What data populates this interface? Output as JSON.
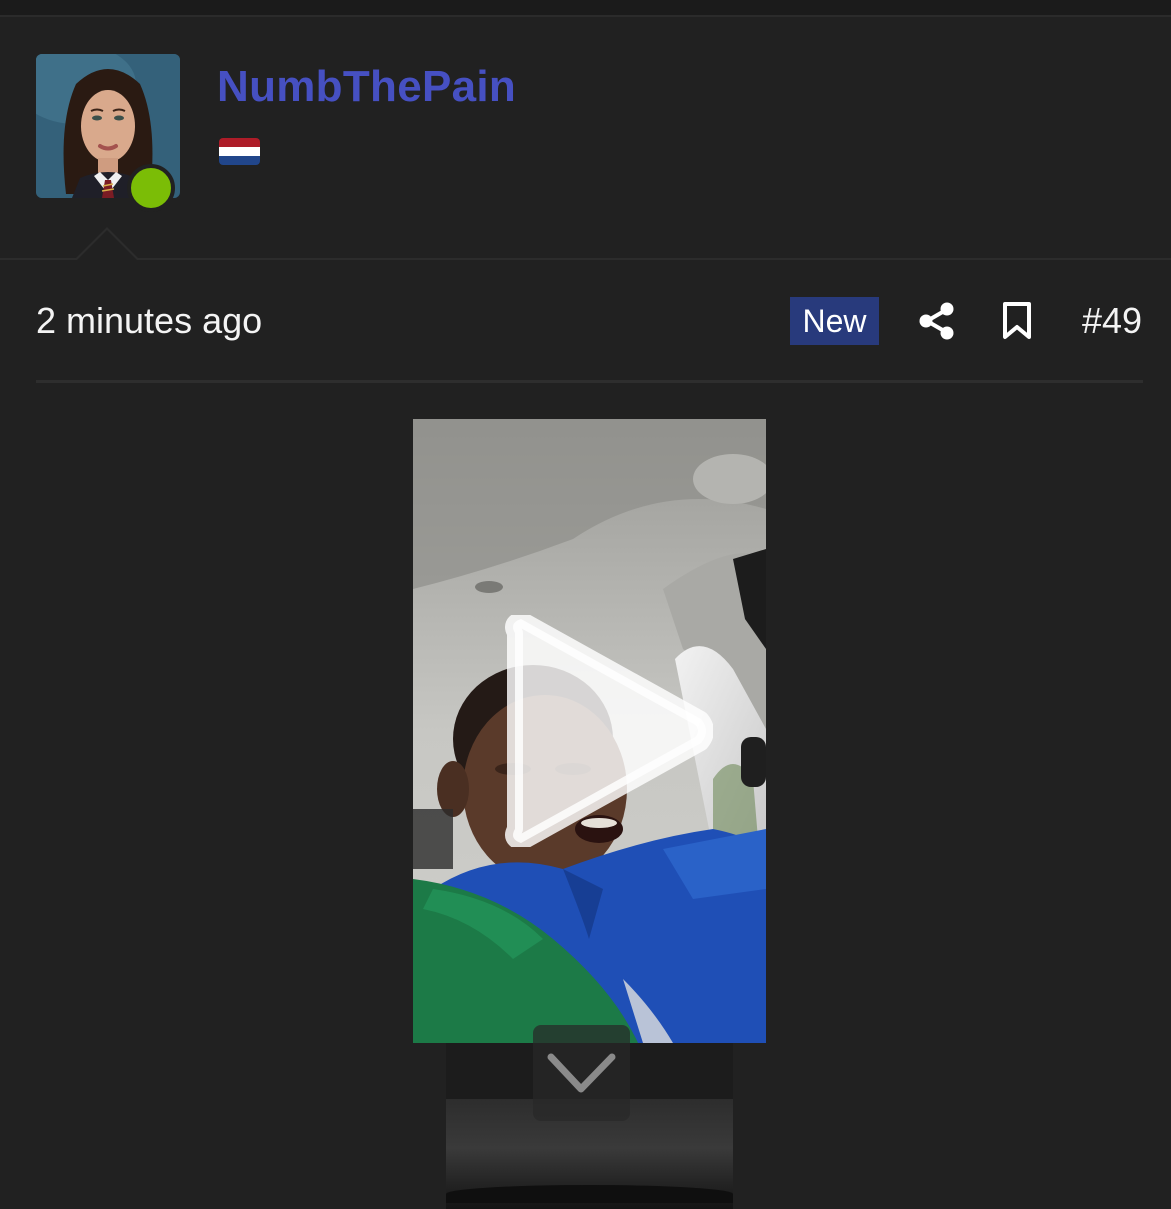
{
  "user": {
    "username": "NumbThePain",
    "avatar_alt": "avatar",
    "online": true,
    "online_color": "#7bbd06",
    "country_flag": "netherlands-flag"
  },
  "post": {
    "timestamp": "2 minutes ago",
    "badge": "New",
    "badge_color": "#283a7c",
    "share_icon": "share-icon",
    "bookmark_icon": "bookmark-icon",
    "number": "#49"
  },
  "video": {
    "play_icon": "play-icon",
    "expand_icon": "chevron-down-icon"
  },
  "colors": {
    "background": "#212121",
    "username": "#4650c2",
    "text": "#f4f4f4"
  }
}
